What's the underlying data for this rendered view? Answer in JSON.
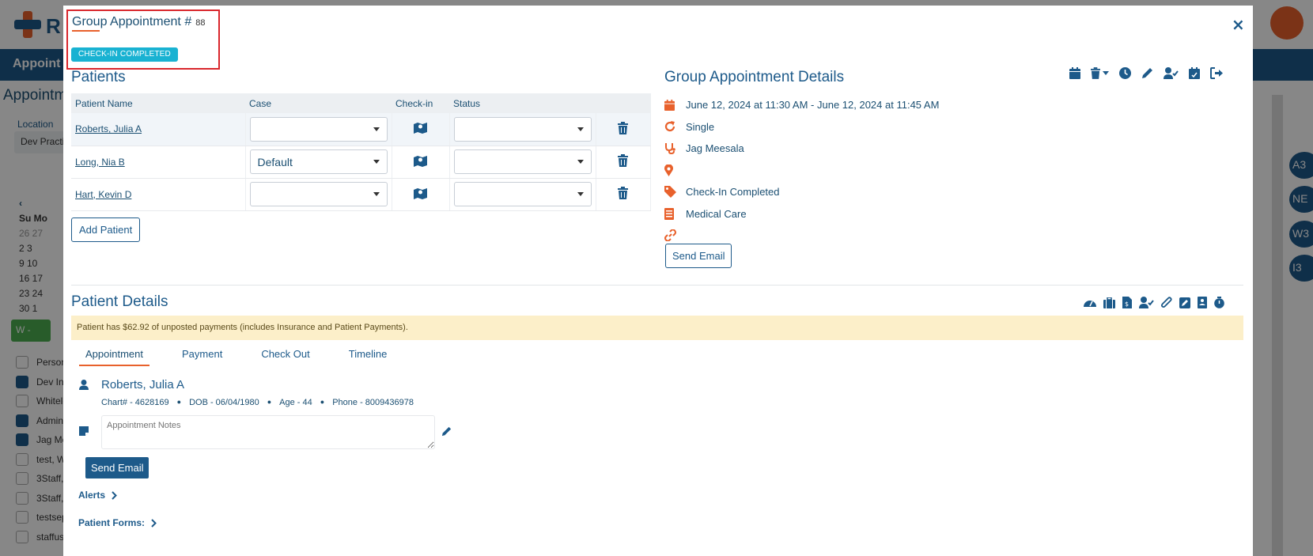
{
  "background": {
    "logo_text": "R",
    "nav_label": "Appoint",
    "page_title": "Appointm",
    "location_label": "Location",
    "location_value": "Dev Practic",
    "calendar_rows": [
      "Su  Mo",
      "26  27",
      "2    3",
      "9    10",
      "16  17",
      "23  24",
      "30   1"
    ],
    "view_button": "W -",
    "list_header": "Person",
    "list_items": [
      {
        "label": "Dev Int",
        "checked": true
      },
      {
        "label": "Whitele",
        "checked": false
      },
      {
        "label": "Admin,",
        "checked": true
      },
      {
        "label": "Jag Me",
        "checked": true
      },
      {
        "label": "test, W",
        "checked": false
      },
      {
        "label": "3Staff,",
        "checked": false
      },
      {
        "label": "3Staff,",
        "checked": false
      },
      {
        "label": "testsep",
        "checked": false
      },
      {
        "label": "staffuse",
        "checked": false
      }
    ],
    "avatars": [
      "A3",
      "NE",
      "W3",
      "I3"
    ]
  },
  "modal": {
    "title": "Group Appointment #",
    "appointment_number": "88",
    "status_badge": "CHECK-IN COMPLETED",
    "close_label": "×"
  },
  "patients": {
    "heading": "Patients",
    "columns": [
      "Patient Name",
      "Case",
      "Check-in",
      "Status"
    ],
    "rows": [
      {
        "name": "Roberts, Julia A",
        "case": "",
        "status": ""
      },
      {
        "name": "Long, Nia B",
        "case": "Default",
        "status": ""
      },
      {
        "name": "Hart, Kevin D",
        "case": "",
        "status": ""
      }
    ],
    "add_button": "Add Patient"
  },
  "group_details": {
    "heading": "Group Appointment Details",
    "datetime": "June 12, 2024 at 11:30 AM - June 12, 2024 at 11:45 AM",
    "recurrence": "Single",
    "provider": "Jag Meesala",
    "location": "",
    "status": "Check-In Completed",
    "type": "Medical Care",
    "link": "",
    "send_email": "Send Email"
  },
  "patient_details": {
    "heading": "Patient Details",
    "banner": "Patient has $62.92 of unposted payments (includes Insurance and Patient Payments).",
    "tabs": [
      "Appointment",
      "Payment",
      "Check Out",
      "Timeline"
    ],
    "active_tab": "Appointment",
    "patient_name": "Roberts, Julia A",
    "chart": "Chart# - 4628169",
    "dob": "DOB - 06/04/1980",
    "age": "Age - 44",
    "phone": "Phone - 8009436978",
    "notes_placeholder": "Appointment Notes",
    "send_email": "Send Email",
    "alerts": "Alerts",
    "forms": "Patient Forms:"
  },
  "colors": {
    "primary": "#1d5a8a",
    "accent": "#e8612c",
    "status_pill": "#19b2d2",
    "banner": "#fcefc9"
  }
}
